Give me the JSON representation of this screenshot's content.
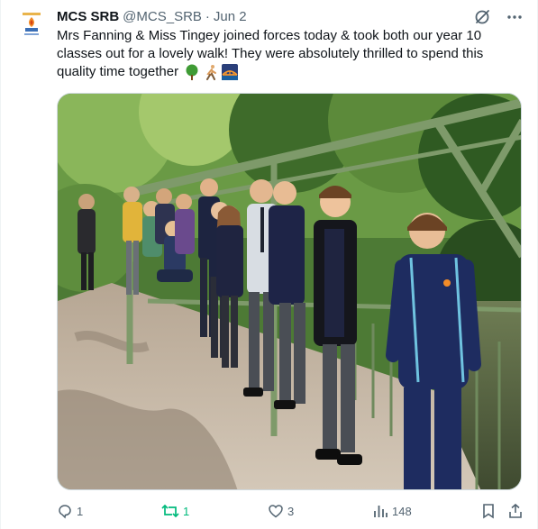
{
  "tweet": {
    "author_name": "MCS SRB",
    "author_handle": "@MCS_SRB",
    "separator": "·",
    "date": "Jun 2",
    "text": "Mrs Fanning & Miss Tingey joined forces today & took both our year 10 classes out for a lovely walk! They were absolutely thrilled to spend this quality time together",
    "emojis": [
      "deciduous-tree-icon",
      "person-walking-icon",
      "bridge-at-night-icon"
    ],
    "image_alt": "Image"
  },
  "actions": {
    "replies": "1",
    "retweets": "1",
    "likes": "3",
    "views": "148"
  },
  "colors": {
    "retweet_active": "#00ba7c",
    "secondary_text": "#536471",
    "primary_text": "#0f1419"
  }
}
